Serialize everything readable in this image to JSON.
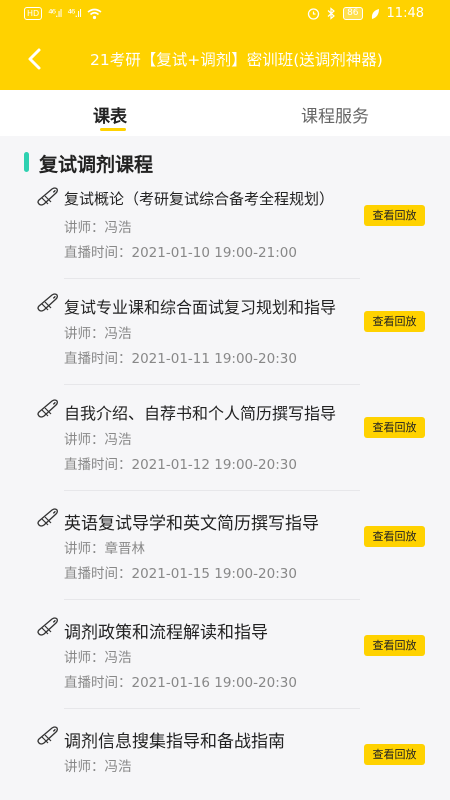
{
  "status_bar": {
    "left_badge": "HD",
    "signal_1": "⁴⁶.ıl",
    "signal_2": "⁴⁶.ıl",
    "battery": "86",
    "time": "11:48"
  },
  "header": {
    "title": "21考研【复试+调剂】密训班(送调剂神器)",
    "back_icon": "back-arrow-icon"
  },
  "tabs": [
    {
      "label": "课表",
      "active": true
    },
    {
      "label": "课程服务",
      "active": false
    }
  ],
  "section": {
    "title": "复试调剂课程",
    "accent_color": "#2ED1B1"
  },
  "colors": {
    "brand": "#FFD200",
    "text_secondary": "#888888"
  },
  "courses": [
    {
      "title": "复试概论（考研复试综合备考全程规划）",
      "teacher": "讲师：冯浩",
      "time": "直播时间：2021-01-10 19:00-21:00",
      "button": "查看回放"
    },
    {
      "title": "复试专业课和综合面试复习规划和指导",
      "teacher": "讲师：冯浩",
      "time": "直播时间：2021-01-11 19:00-20:30",
      "button": "查看回放"
    },
    {
      "title": "自我介绍、自荐书和个人简历撰写指导",
      "teacher": "讲师：冯浩",
      "time": "直播时间：2021-01-12 19:00-20:30",
      "button": "查看回放"
    },
    {
      "title": "英语复试导学和英文简历撰写指导",
      "teacher": "讲师：章晋林",
      "time": "直播时间：2021-01-15 19:00-20:30",
      "button": "查看回放"
    },
    {
      "title": "调剂政策和流程解读和指导",
      "teacher": "讲师：冯浩",
      "time": "直播时间：2021-01-16 19:00-20:30",
      "button": "查看回放"
    },
    {
      "title": "调剂信息搜集指导和备战指南",
      "teacher": "讲师：冯浩",
      "time": "",
      "button": "查看回放"
    }
  ]
}
